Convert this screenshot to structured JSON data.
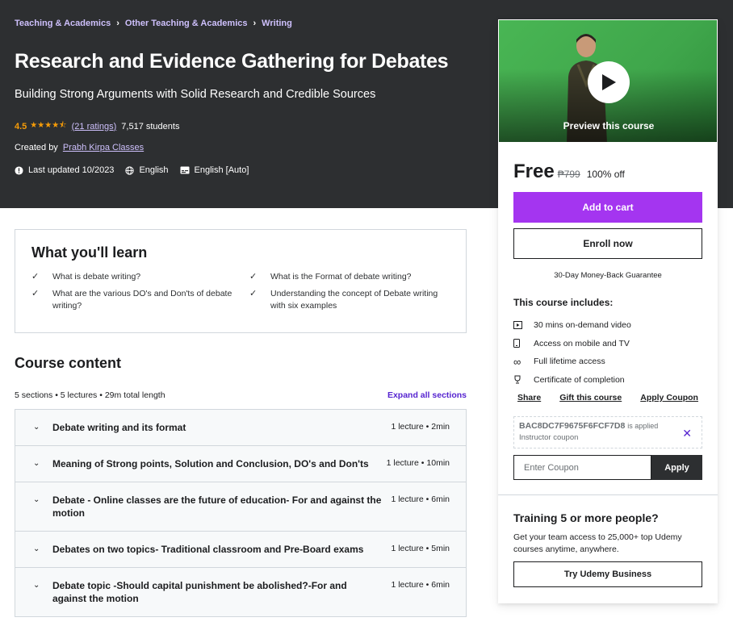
{
  "breadcrumb": [
    "Teaching & Academics",
    "Other Teaching & Academics",
    "Writing"
  ],
  "course": {
    "title": "Research and Evidence Gathering for Debates",
    "subtitle": "Building Strong Arguments with Solid Research and Credible Sources",
    "rating": "4.5",
    "stars": "★★★★⯪",
    "ratings_count": "(21 ratings)",
    "students": "7,517 students",
    "created_by_label": "Created by",
    "author": "Prabh Kirpa Classes",
    "last_updated": "Last updated 10/2023",
    "language": "English",
    "captions": "English [Auto]"
  },
  "learn": {
    "title": "What you'll learn",
    "items": [
      "What is debate writing?",
      "What is the Format of debate writing?",
      "What are the various DO's and Don'ts of debate writing?",
      "Understanding the concept of Debate writing with six examples"
    ]
  },
  "course_content": {
    "title": "Course content",
    "summary": "5 sections • 5 lectures • 29m total length",
    "expand_label": "Expand all sections",
    "sections": [
      {
        "title": "Debate writing and its format",
        "info": "1 lecture • 2min"
      },
      {
        "title": "Meaning of Strong points, Solution and Conclusion, DO's and Don'ts",
        "info": "1 lecture • 10min"
      },
      {
        "title": "Debate - Online classes are the future of education- For and against the motion",
        "info": "1 lecture • 6min"
      },
      {
        "title": "Debates on two topics- Traditional classroom and Pre-Board exams",
        "info": "1 lecture • 5min"
      },
      {
        "title": "Debate topic -Should capital punishment be abolished?-For and against the motion",
        "info": "1 lecture • 6min"
      }
    ]
  },
  "sidebar": {
    "preview_label": "Preview this course",
    "price": "Free",
    "original_price": "₱799",
    "discount": "100% off",
    "add_to_cart": "Add to cart",
    "enroll": "Enroll now",
    "guarantee": "30-Day Money-Back Guarantee",
    "includes_title": "This course includes:",
    "includes": [
      {
        "icon": "video-icon",
        "text": "30 mins on-demand video"
      },
      {
        "icon": "mobile-icon",
        "text": "Access on mobile and TV"
      },
      {
        "icon": "infinity-icon",
        "text": "Full lifetime access"
      },
      {
        "icon": "trophy-icon",
        "text": "Certificate of completion"
      }
    ],
    "share": "Share",
    "gift": "Gift this course",
    "apply_coupon": "Apply Coupon",
    "coupon_code": "BAC8DC7F9675F6FCF7D8",
    "coupon_applied": "is applied",
    "coupon_type": "Instructor coupon",
    "coupon_placeholder": "Enter Coupon",
    "apply": "Apply",
    "team_title": "Training 5 or more people?",
    "team_desc": "Get your team access to 25,000+ top Udemy courses anytime, anywhere.",
    "business_button": "Try Udemy Business"
  },
  "colors": {
    "header_bg": "#2d2f31",
    "accent_purple": "#a435f0",
    "link_purple": "#5624d0",
    "breadcrumb_link": "#cec0fc",
    "star_orange": "#f69c08"
  }
}
